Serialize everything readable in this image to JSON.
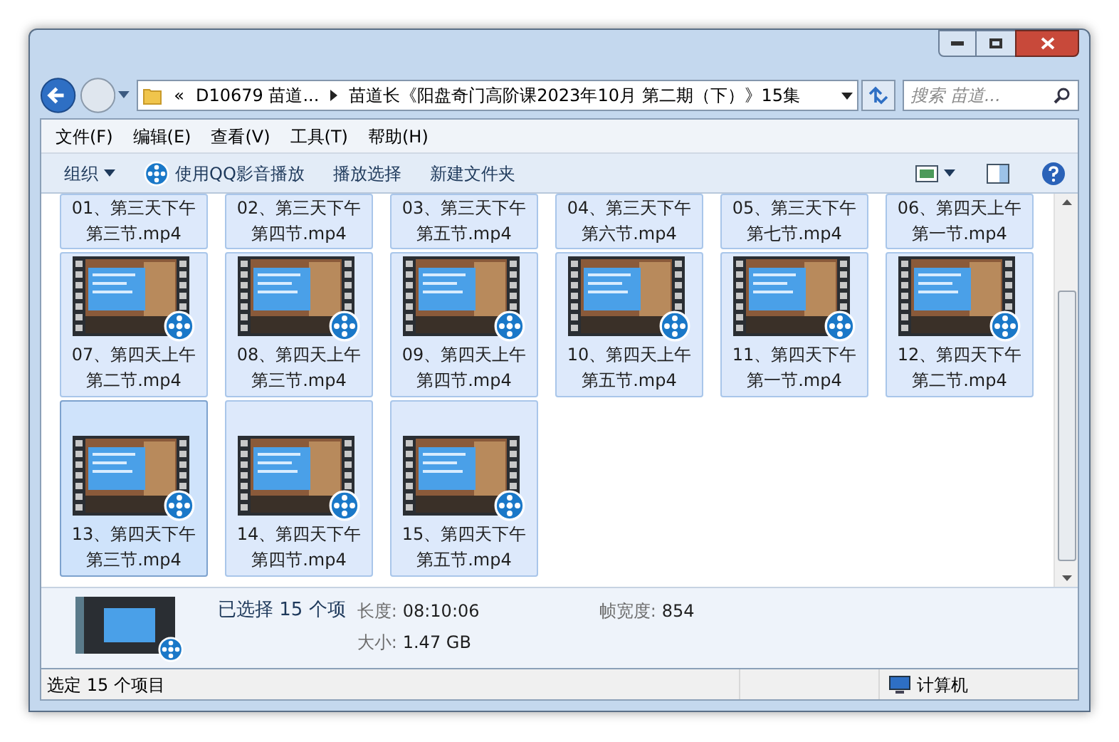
{
  "address": {
    "overflow": "«",
    "crumbs": [
      "D10679 苗道...",
      "苗道长《阳盘奇门高阶课2023年10月 第二期（下）》15集"
    ]
  },
  "search": {
    "placeholder": "搜索 苗道..."
  },
  "menu": [
    "文件(F)",
    "编辑(E)",
    "查看(V)",
    "工具(T)",
    "帮助(H)"
  ],
  "toolbar": [
    {
      "label": "组织",
      "kind": "dropdown"
    },
    {
      "label": "使用QQ影音播放",
      "kind": "player"
    },
    {
      "label": "播放选择",
      "kind": "plain"
    },
    {
      "label": "新建文件夹",
      "kind": "plain"
    }
  ],
  "files": [
    {
      "name": "01、第三天下午第三节.mp4",
      "selected": true,
      "hot": false,
      "thumbnail_visible": false
    },
    {
      "name": "02、第三天下午第四节.mp4",
      "selected": true,
      "hot": false,
      "thumbnail_visible": false
    },
    {
      "name": "03、第三天下午第五节.mp4",
      "selected": true,
      "hot": false,
      "thumbnail_visible": false
    },
    {
      "name": "04、第三天下午第六节.mp4",
      "selected": true,
      "hot": false,
      "thumbnail_visible": false
    },
    {
      "name": "05、第三天下午第七节.mp4",
      "selected": true,
      "hot": false,
      "thumbnail_visible": false
    },
    {
      "name": "06、第四天上午第一节.mp4",
      "selected": true,
      "hot": false,
      "thumbnail_visible": false
    },
    {
      "name": "07、第四天上午第二节.mp4",
      "selected": true,
      "hot": false,
      "thumbnail_visible": true
    },
    {
      "name": "08、第四天上午第三节.mp4",
      "selected": true,
      "hot": false,
      "thumbnail_visible": true
    },
    {
      "name": "09、第四天上午第四节.mp4",
      "selected": true,
      "hot": false,
      "thumbnail_visible": true
    },
    {
      "name": "10、第四天上午第五节.mp4",
      "selected": true,
      "hot": false,
      "thumbnail_visible": true
    },
    {
      "name": "11、第四天下午第一节.mp4",
      "selected": true,
      "hot": false,
      "thumbnail_visible": true
    },
    {
      "name": "12、第四天下午第二节.mp4",
      "selected": true,
      "hot": false,
      "thumbnail_visible": true
    },
    {
      "name": "13、第四天下午第三节.mp4",
      "selected": true,
      "hot": true,
      "thumbnail_visible": true
    },
    {
      "name": "14、第四天下午第四节.mp4",
      "selected": true,
      "hot": false,
      "thumbnail_visible": true
    },
    {
      "name": "15、第四天下午第五节.mp4",
      "selected": true,
      "hot": false,
      "thumbnail_visible": true
    }
  ],
  "details": {
    "summary": "已选择 15 个项",
    "fields": [
      {
        "label": "长度:",
        "value": "08:10:06"
      },
      {
        "label": "帧宽度:",
        "value": "854"
      },
      {
        "label": "大小:",
        "value": "1.47 GB"
      }
    ]
  },
  "status_bar": {
    "text": "选定 15 个项目",
    "location": "计算机"
  }
}
